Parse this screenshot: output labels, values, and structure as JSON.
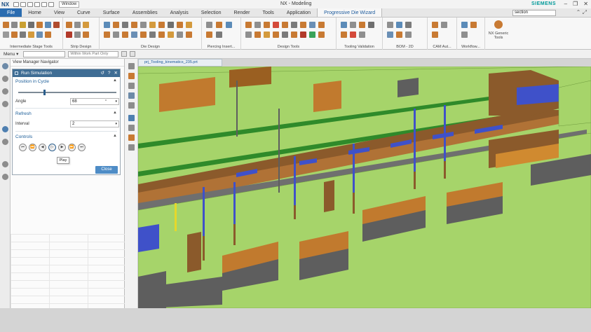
{
  "titlebar": {
    "app_logo": "NX",
    "window_menu": "Window",
    "title": "NX - Modeling",
    "brand": "SIEMENS",
    "minimize": "–",
    "restore": "❐",
    "close": "✕"
  },
  "ribbon_tabs": [
    {
      "label": "File"
    },
    {
      "label": "Home"
    },
    {
      "label": "View"
    },
    {
      "label": "Curve"
    },
    {
      "label": "Surface"
    },
    {
      "label": "Assemblies"
    },
    {
      "label": "Analysis"
    },
    {
      "label": "Selection"
    },
    {
      "label": "Render"
    },
    {
      "label": "Tools"
    },
    {
      "label": "Application"
    },
    {
      "label": "Progressive Die Wizard"
    }
  ],
  "ribbon_search": {
    "value": "section"
  },
  "ribbon_groups": [
    {
      "label": "Intermediate Stage Tools"
    },
    {
      "label": "Strip Design"
    },
    {
      "label": "Die Design"
    },
    {
      "label": "Piercing Insert..."
    },
    {
      "label": "Design Tools"
    },
    {
      "label": "Tooling Validation"
    },
    {
      "label": "BOM - 2D"
    },
    {
      "label": "CAM Aut..."
    },
    {
      "label": "Workflow..."
    },
    {
      "label": "NX Generic Tools"
    }
  ],
  "selection_bar": {
    "menu": "Menu ▾",
    "filter_value": "",
    "scope_value": "Within Work Part Only"
  },
  "navigator": {
    "title": "View Manager Navigator"
  },
  "dialog": {
    "title": "Run Simulation",
    "help": "?",
    "reset": "↺",
    "close": "✕",
    "position_section": "Position in Cycle",
    "slider_fraction": 0.26,
    "angle_label": "Angle",
    "angle_value": "68",
    "angle_unit": "°",
    "refresh_section": "Refresh",
    "interval_label": "Interval",
    "interval_value": "2",
    "controls_section": "Controls",
    "controls": [
      "⏮",
      "⏪",
      "◀",
      "▷",
      "▶",
      "⏩",
      "⏭"
    ],
    "tooltip": "Play",
    "close_button": "Close"
  },
  "document_tab": {
    "label": "prj_Tooling_kinematics_235.prt"
  },
  "colors": {
    "file_tab": "#2b6cb0",
    "dialog_header": "#3f6d94",
    "die_green": "#a6d46a",
    "steel_gray": "#5e5e5e",
    "copper": "#c77c35",
    "blue_pin": "#3f51c9",
    "accent": "#1c5a9c"
  }
}
